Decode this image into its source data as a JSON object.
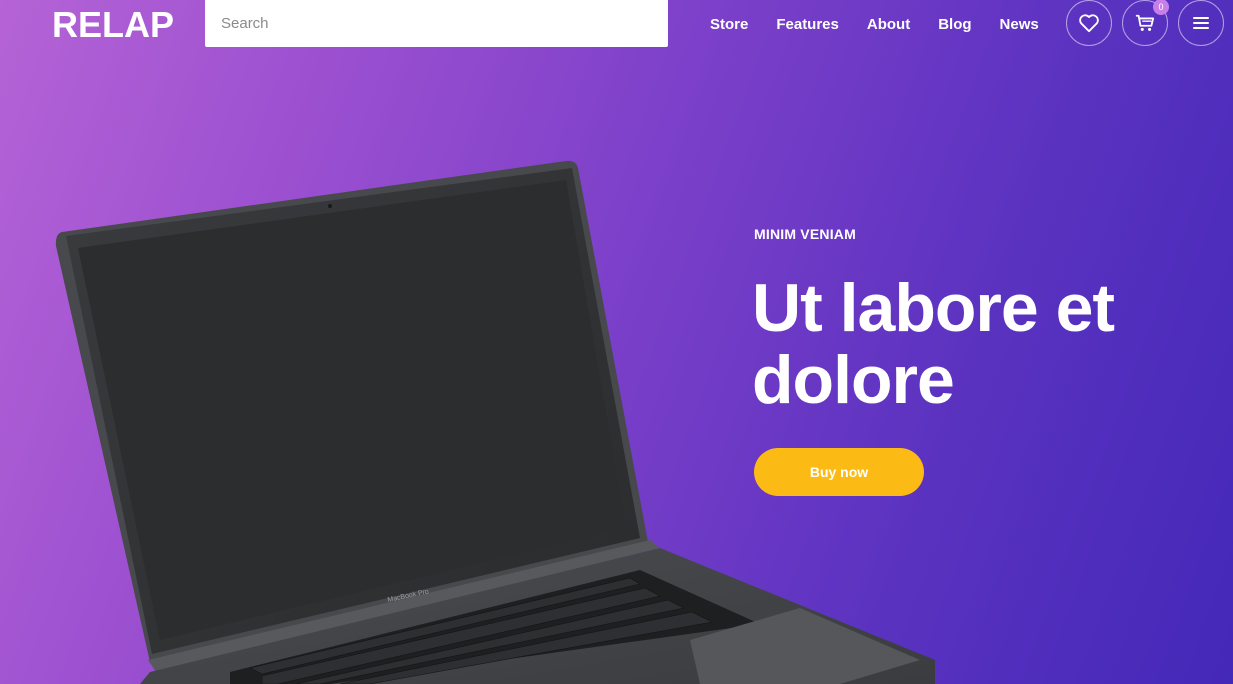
{
  "header": {
    "logo": "RELAP",
    "search_placeholder": "Search",
    "nav": [
      "Store",
      "Features",
      "About",
      "Blog",
      "News"
    ],
    "cart_count": "0"
  },
  "hero": {
    "eyebrow": "MINIM VENIAM",
    "headline_line1": "Ut labore et",
    "headline_line2": "dolore",
    "cta_label": "Buy now",
    "device_label": "MacBook Pro"
  },
  "colors": {
    "gradient_start": "#b563d6",
    "gradient_end": "#4428b8",
    "cta": "#fbbb14",
    "badge": "#c77ee8"
  },
  "icons": [
    "heart-icon",
    "cart-icon",
    "menu-icon"
  ]
}
